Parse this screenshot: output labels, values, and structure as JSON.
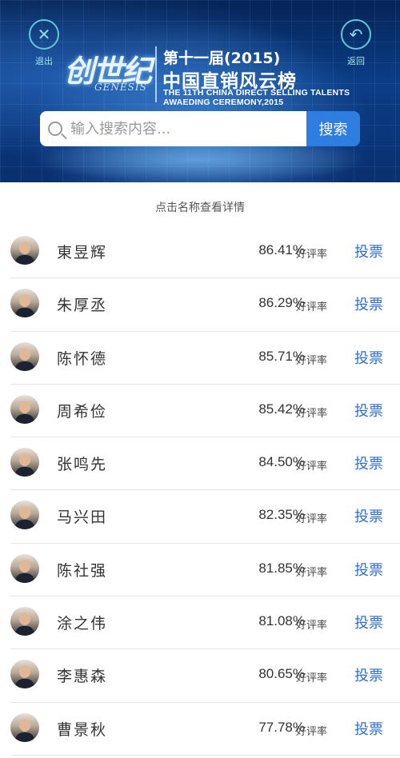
{
  "header": {
    "exit_label": "退出",
    "back_label": "返回",
    "brand": "创世纪",
    "brand_sub": "GENESIS",
    "edition": "第十一届(2015)",
    "title": "中国直销风云榜",
    "title_en_line1": "THE 11TH CHINA DIRECT SELLING TALENTS",
    "title_en_line2": "AWAEDING CEREMONY,2015"
  },
  "search": {
    "placeholder": "输入搜索内容...",
    "button_label": "搜索"
  },
  "hint": "点击名称查看详情",
  "rate_suffix": "好评率",
  "vote_label": "投票",
  "candidates": [
    {
      "name": "東昱辉",
      "rate": "86.41%"
    },
    {
      "name": "朱厚丞",
      "rate": "86.29%"
    },
    {
      "name": "陈怀德",
      "rate": "85.71%"
    },
    {
      "name": "周希俭",
      "rate": "85.42%"
    },
    {
      "name": "张鸣先",
      "rate": "84.50%"
    },
    {
      "name": "马兴田",
      "rate": "82.35%"
    },
    {
      "name": "陈社强",
      "rate": "81.85%"
    },
    {
      "name": "涂之伟",
      "rate": "81.08%"
    },
    {
      "name": "李惠森",
      "rate": "80.65%"
    },
    {
      "name": "曹景秋",
      "rate": "77.78%"
    }
  ],
  "colors": {
    "accent": "#2e7de0",
    "vote_text": "#2f6fc9",
    "banner_dark": "#062456"
  }
}
